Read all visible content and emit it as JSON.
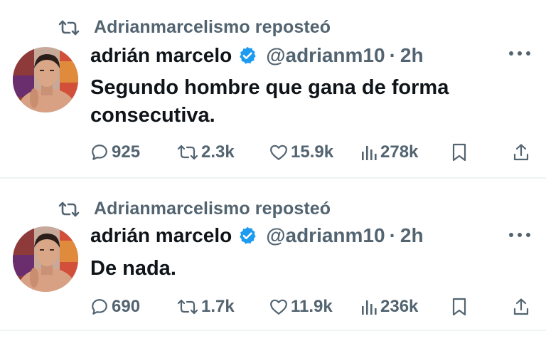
{
  "colors": {
    "primary_text": "#0f1419",
    "secondary_text": "#536471",
    "verified_blue": "#1d9bf0",
    "divider": "#eff3f4"
  },
  "tweets": [
    {
      "repost_label": "Adrianmarcelismo reposteó",
      "display_name": "adrián marcelo",
      "handle": "@adrianm10",
      "separator": "·",
      "time": "2h",
      "text": "Segundo hombre que gana de forma consecutiva.",
      "replies": "925",
      "reposts": "2.3k",
      "likes": "15.9k",
      "views": "278k",
      "icons": [
        "repost-icon",
        "verified-badge-icon",
        "more-icon",
        "reply-icon",
        "repost-icon",
        "like-icon",
        "views-icon",
        "bookmark-icon",
        "share-icon"
      ]
    },
    {
      "repost_label": "Adrianmarcelismo reposteó",
      "display_name": "adrián marcelo",
      "handle": "@adrianm10",
      "separator": "·",
      "time": "2h",
      "text": "De nada.",
      "replies": "690",
      "reposts": "1.7k",
      "likes": "11.9k",
      "views": "236k",
      "icons": [
        "repost-icon",
        "verified-badge-icon",
        "more-icon",
        "reply-icon",
        "repost-icon",
        "like-icon",
        "views-icon",
        "bookmark-icon",
        "share-icon"
      ]
    }
  ]
}
